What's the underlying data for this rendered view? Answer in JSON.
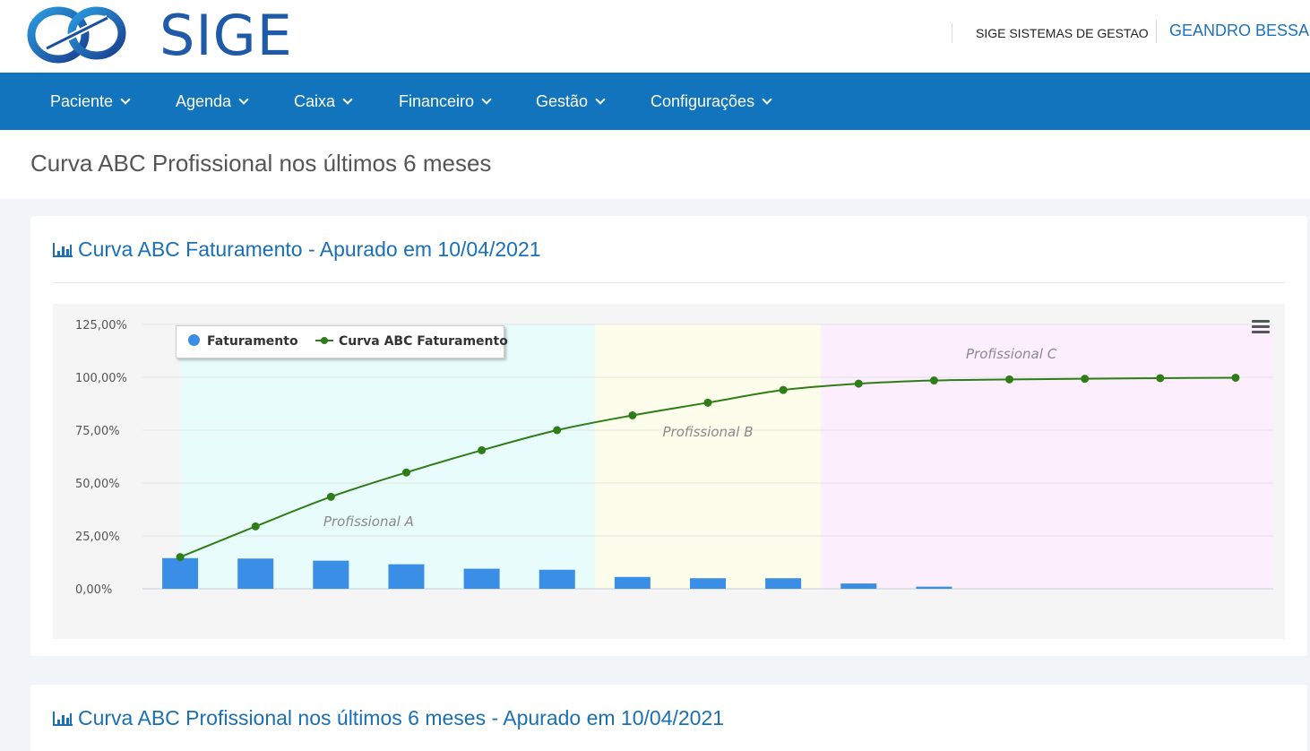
{
  "header": {
    "logo_text": "SIGE",
    "company": "SIGE SISTEMAS DE GESTAO",
    "user": "GEANDRO BESSA"
  },
  "nav": [
    {
      "label": "Paciente"
    },
    {
      "label": "Agenda"
    },
    {
      "label": "Caixa"
    },
    {
      "label": "Financeiro"
    },
    {
      "label": "Gestão"
    },
    {
      "label": "Configurações"
    }
  ],
  "page": {
    "title": "Curva ABC Profissional nos últimos 6 meses"
  },
  "panels": [
    {
      "title": "Curva ABC Faturamento - Apurado em 10/04/2021"
    },
    {
      "title": "Curva ABC Profissional nos últimos 6 meses - Apurado em 10/04/2021"
    }
  ],
  "colors": {
    "nav_bg": "#1274bd",
    "bar": "#3a8ee6",
    "line": "#2e7d16",
    "band_a": "#e9fcfc",
    "band_b": "#fdfdeb",
    "band_c": "#fdeefd"
  },
  "chart_data": {
    "type": "bar",
    "x": [
      "1",
      "2",
      "3",
      "4",
      "5",
      "6",
      "7",
      "8",
      "9",
      "10",
      "11",
      "12",
      "13",
      "14",
      "15"
    ],
    "ylim": [
      0,
      125
    ],
    "y_ticks": [
      "0,00%",
      "25,00%",
      "50,00%",
      "75,00%",
      "100,00%",
      "125,00%"
    ],
    "series": [
      {
        "name": "Faturamento",
        "type": "bar",
        "values": [
          14.5,
          14.3,
          13.3,
          11.6,
          9.5,
          9.0,
          5.6,
          5.0,
          5.0,
          2.5,
          1.0,
          0,
          0,
          0,
          0
        ]
      },
      {
        "name": "Curva ABC Faturamento",
        "type": "line",
        "values": [
          15.0,
          29.5,
          43.5,
          55.0,
          65.5,
          75.0,
          82.0,
          88.0,
          94.0,
          97.0,
          98.5,
          99.0,
          99.3,
          99.6,
          99.8
        ]
      }
    ],
    "bands": [
      {
        "label": "Profissional A",
        "from": 0,
        "to": 6
      },
      {
        "label": "Profissional B",
        "from": 6,
        "to": 9
      },
      {
        "label": "Profissional C",
        "from": 9,
        "to": 15
      }
    ],
    "legend": "top-left",
    "grid": true
  }
}
